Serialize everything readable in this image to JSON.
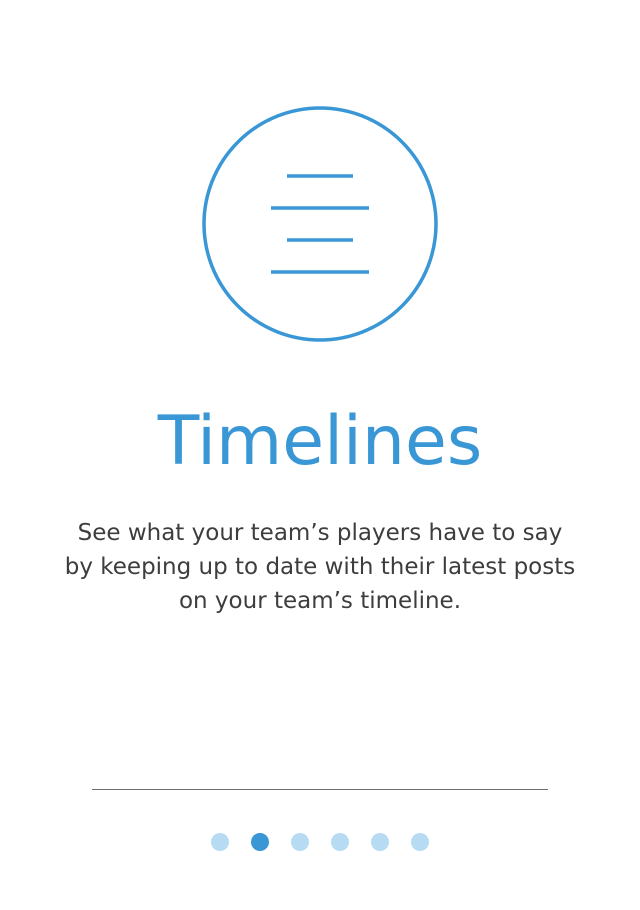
{
  "onboarding": {
    "icon": "timeline-list-icon",
    "title": "Timelines",
    "description": "See what your team’s players have to say by keeping up to date with their latest posts on your team’s timeline."
  },
  "pager": {
    "total_pages": 6,
    "active_index": 1
  },
  "colors": {
    "accent": "#3a97d6",
    "dot_inactive": "#b6dbf3",
    "text": "#3d3d3d",
    "divider": "#6e6e6e"
  }
}
